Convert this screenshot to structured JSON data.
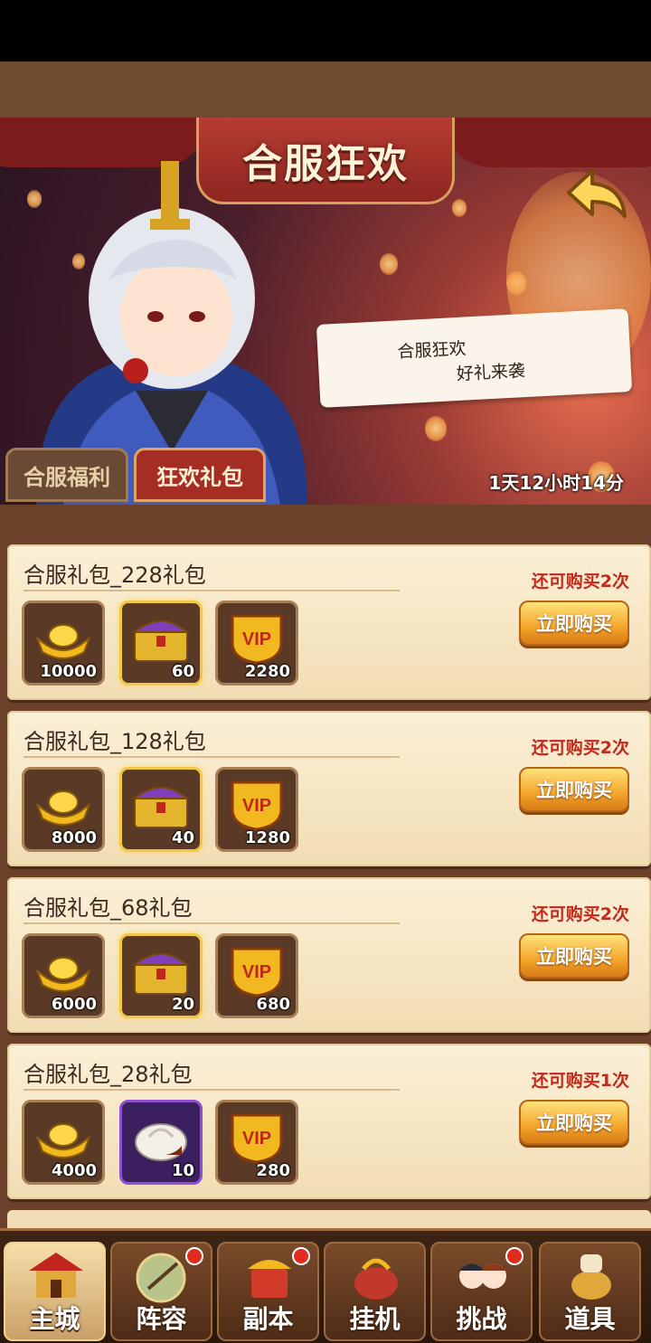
{
  "header": {
    "title": "合服狂欢",
    "speech_line1": "合服狂欢",
    "speech_line2": "好礼来袭",
    "tabs": [
      {
        "label": "合服福利",
        "active": false
      },
      {
        "label": "狂欢礼包",
        "active": true
      }
    ],
    "countdown": "1天12小时14分"
  },
  "packs": [
    {
      "title": "合服礼包_228礼包",
      "remaining": "还可购买2次",
      "buy_label": "立即购买",
      "items": [
        {
          "icon": "gold-ingot-icon",
          "count": "10000"
        },
        {
          "icon": "treasure-chest-icon",
          "count": "60"
        },
        {
          "icon": "vip-badge-icon",
          "count": "2280"
        }
      ]
    },
    {
      "title": "合服礼包_128礼包",
      "remaining": "还可购买2次",
      "buy_label": "立即购买",
      "items": [
        {
          "icon": "gold-ingot-icon",
          "count": "8000"
        },
        {
          "icon": "treasure-chest-icon",
          "count": "40"
        },
        {
          "icon": "vip-badge-icon",
          "count": "1280"
        }
      ]
    },
    {
      "title": "合服礼包_68礼包",
      "remaining": "还可购买2次",
      "buy_label": "立即购买",
      "items": [
        {
          "icon": "gold-ingot-icon",
          "count": "6000"
        },
        {
          "icon": "treasure-chest-icon",
          "count": "20"
        },
        {
          "icon": "vip-badge-icon",
          "count": "680"
        }
      ]
    },
    {
      "title": "合服礼包_28礼包",
      "remaining": "还可购买1次",
      "buy_label": "立即购买",
      "items": [
        {
          "icon": "gold-ingot-icon",
          "count": "4000"
        },
        {
          "icon": "steamed-bun-icon",
          "count": "10"
        },
        {
          "icon": "vip-badge-icon",
          "count": "280"
        }
      ]
    }
  ],
  "nav": [
    {
      "label": "主城",
      "icon": "main-city-icon",
      "badge": false,
      "active": true
    },
    {
      "label": "阵容",
      "icon": "lineup-icon",
      "badge": true,
      "active": false
    },
    {
      "label": "副本",
      "icon": "dungeon-icon",
      "badge": true,
      "active": false
    },
    {
      "label": "挂机",
      "icon": "idle-icon",
      "badge": false,
      "active": false
    },
    {
      "label": "挑战",
      "icon": "challenge-icon",
      "badge": true,
      "active": false
    },
    {
      "label": "道具",
      "icon": "items-icon",
      "badge": false,
      "active": false
    }
  ],
  "colors": {
    "accent_red": "#c4281c",
    "button_gold": "#f2a52a",
    "card_bg": "#fbf0d6",
    "panel_brown": "#6b4229"
  }
}
